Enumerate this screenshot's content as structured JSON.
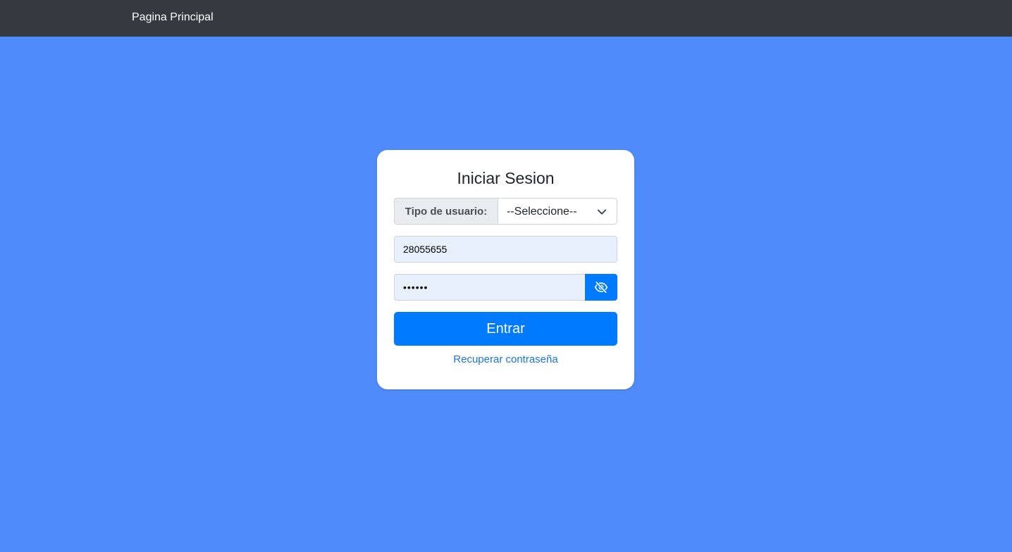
{
  "navbar": {
    "brand": "Pagina Principal"
  },
  "login": {
    "title": "Iniciar Sesion",
    "user_type_label": "Tipo de usuario:",
    "user_type_selected": "--Seleccione--",
    "username_value": "28055655",
    "password_value": "••••••",
    "submit_label": "Entrar",
    "recover_link": "Recuperar contraseña"
  },
  "icons": {
    "select_arrow": "chevron-down-icon",
    "toggle_password": "eye-slash-icon"
  },
  "colors": {
    "background": "#4f8bfb",
    "navbar": "#343a40",
    "primary": "#007bff",
    "autofill": "#e8f0fe",
    "link": "#1a73e8"
  }
}
